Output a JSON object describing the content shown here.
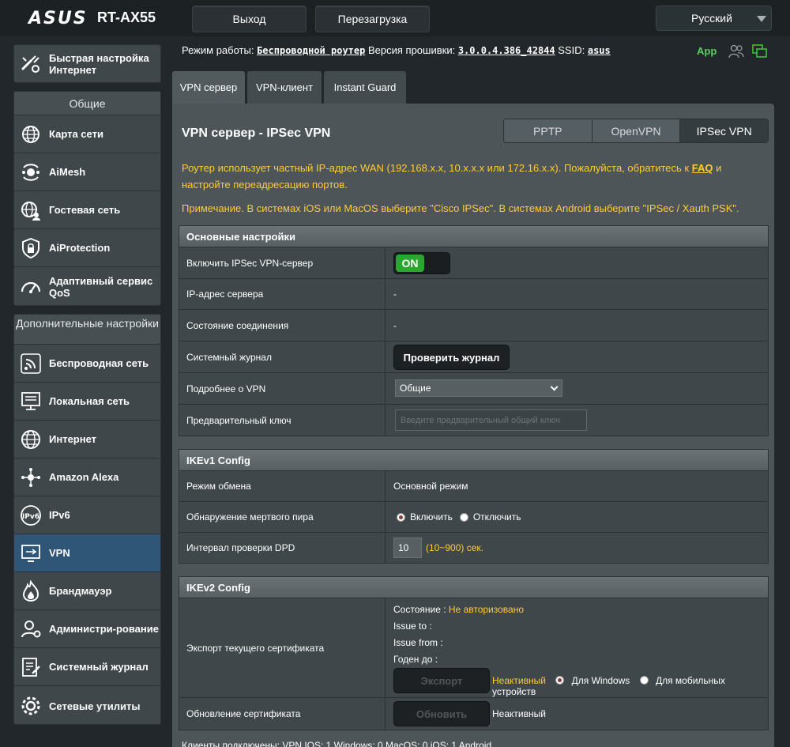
{
  "header": {
    "logo": "ASUS",
    "model": "RT-AX55",
    "logout": "Выход",
    "reboot": "Перезагрузка",
    "language": "Русский"
  },
  "status": {
    "mode_label": "Режим работы:",
    "mode_value": "Беспроводной роутер",
    "fw_label": "Версия прошивки:",
    "fw_value": "3.0.0.4.386_42844",
    "ssid_label": "SSID:",
    "ssid_value": "asus",
    "app": "App"
  },
  "sidebar": {
    "quick": "Быстрая настройка Интернет",
    "general_header": "Общие",
    "general": [
      "Карта сети",
      "AiMesh",
      "Гостевая сеть",
      "AiProtection",
      "Адаптивный сервис QoS"
    ],
    "advanced_header": "Дополнительные настройки",
    "advanced": [
      "Беспроводная сеть",
      "Локальная сеть",
      "Интернет",
      "Amazon Alexa",
      "IPv6",
      "VPN",
      "Брандмауэр",
      "Администри-рование",
      "Системный журнал",
      "Сетевые утилиты"
    ]
  },
  "tabs": [
    "VPN сервер",
    "VPN-клиент",
    "Instant Guard"
  ],
  "page": {
    "title": "VPN сервер - IPSec VPN",
    "seg": [
      "PPTP",
      "OpenVPN",
      "IPSec VPN"
    ],
    "note1_a": "Роутер использует частный IP-адрес WAN (192.168.x.x, 10.x.x.x или 172.16.x.x). Пожалуйста, обратитесь к",
    "note1_link": "FAQ",
    "note1_b": "и",
    "note1_c": "настройте переадресацию портов.",
    "note2": "Примечание. В системах iOS или MacOS выберите \"Cisco IPSec\". В системах Android выберите \"IPSec / Xauth PSK\"."
  },
  "basic": {
    "header": "Основные настройки",
    "enable_label": "Включить IPSec VPN-сервер",
    "toggle": "ON",
    "ip_label": "IP-адрес сервера",
    "ip_value": "-",
    "conn_label": "Состояние соединения",
    "conn_value": "-",
    "log_label": "Системный журнал",
    "log_button": "Проверить журнал",
    "details_label": "Подробнее о VPN",
    "details_value": "Общие",
    "psk_label": "Предварительный ключ",
    "psk_placeholder": "Введите предварительный общий ключ"
  },
  "ikev1": {
    "header": "IKEv1 Config",
    "exchange_label": "Режим обмена",
    "exchange_value": "Основной режим",
    "dpd_label": "Обнаружение мертвого пира",
    "dpd_on": "Включить",
    "dpd_off": "Отключить",
    "interval_label": "Интервал проверки DPD",
    "interval_value": "10",
    "interval_hint": "(10~900)",
    "interval_unit": "сек."
  },
  "ikev2": {
    "header": "IKEv2 Config",
    "export_label": "Экспорт текущего сертификата",
    "state_label": "Состояние :",
    "state_value": "Не авторизовано",
    "issue_to": "Issue to :",
    "issue_from": "Issue from :",
    "valid": "Годен до :",
    "export_button": "Экспорт",
    "inactive": "Неактивный",
    "for_windows": "Для Windows",
    "for_mobile": "Для мобильных устройств",
    "update_label": "Обновление сертификата",
    "update_button": "Обновить",
    "update_status": "Неактивный"
  },
  "footer": "Клиенты подключены: VPN IOS: 1  Windows: 0  MacOS: 0  iOS: 1  Android"
}
